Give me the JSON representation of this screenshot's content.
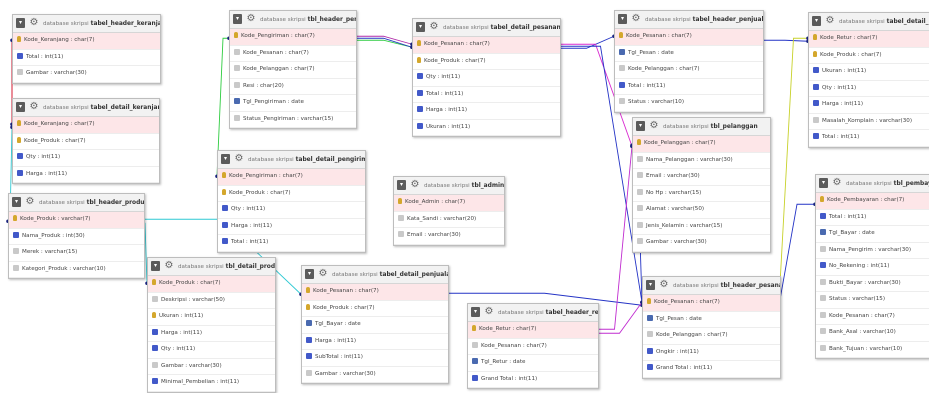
{
  "schema_prefix": "database skripsi",
  "tables": [
    {
      "id": "t_hdr_keranjang",
      "name": "tabel_header_keranjang",
      "cols": [
        {
          "label": "Kode_Keranjang : char(7)",
          "icon": "key",
          "pk": true
        },
        {
          "label": "Total : int(11)",
          "icon": "num"
        },
        {
          "label": "Gambar : varchar(30)",
          "icon": "txt"
        }
      ]
    },
    {
      "id": "t_det_keranjang",
      "name": "tabel_detail_keranjang",
      "cols": [
        {
          "label": "Kode_Keranjang : char(7)",
          "icon": "key",
          "pk": true
        },
        {
          "label": "Kode_Produk : char(7)",
          "icon": "key"
        },
        {
          "label": "Qty : int(11)",
          "icon": "num"
        },
        {
          "label": "Harga : int(11)",
          "icon": "num"
        }
      ]
    },
    {
      "id": "t_hdr_produk",
      "name": "tbl_header_produk",
      "cols": [
        {
          "label": "Kode_Produk : varchar(7)",
          "icon": "key",
          "pk": true
        },
        {
          "label": "Nama_Produk : int(30)",
          "icon": "num"
        },
        {
          "label": "Merek : varchar(15)",
          "icon": "txt"
        },
        {
          "label": "Kategori_Produk : varchar(10)",
          "icon": "txt"
        }
      ]
    },
    {
      "id": "t_hdr_pengiriman",
      "name": "tbl_header_pengiriman",
      "cols": [
        {
          "label": "Kode_Pengiriman : char(7)",
          "icon": "key",
          "pk": true
        },
        {
          "label": "Kode_Pesanan : char(7)",
          "icon": "txt"
        },
        {
          "label": "Kode_Pelanggan : char(7)",
          "icon": "txt"
        },
        {
          "label": "Resi : char(20)",
          "icon": "txt"
        },
        {
          "label": "Tgl_Pengiriman : date",
          "icon": "date"
        },
        {
          "label": "Status_Pengiriman : varchar(15)",
          "icon": "txt"
        }
      ]
    },
    {
      "id": "t_det_pengiriman",
      "name": "tabel_detail_pengiriman",
      "cols": [
        {
          "label": "Kode_Pengiriman : char(7)",
          "icon": "key",
          "pk": true
        },
        {
          "label": "Kode_Produk : char(7)",
          "icon": "key"
        },
        {
          "label": "Qty : int(11)",
          "icon": "num"
        },
        {
          "label": "Harga : int(11)",
          "icon": "num"
        },
        {
          "label": "Total : int(11)",
          "icon": "num"
        }
      ]
    },
    {
      "id": "t_det_pesanan",
      "name": "tabel_detail_pesanan",
      "cols": [
        {
          "label": "Kode_Pesanan : char(7)",
          "icon": "key",
          "pk": true
        },
        {
          "label": "Kode_Produk : char(7)",
          "icon": "key"
        },
        {
          "label": "Qty : int(11)",
          "icon": "num"
        },
        {
          "label": "Total : int(11)",
          "icon": "num"
        },
        {
          "label": "Harga : int(11)",
          "icon": "num"
        },
        {
          "label": "Ukuran : int(11)",
          "icon": "num"
        }
      ]
    },
    {
      "id": "t_admin",
      "name": "tbl_admin",
      "cols": [
        {
          "label": "Kode_Admin : char(7)",
          "icon": "key",
          "pk": true
        },
        {
          "label": "Kata_Sandi : varchar(20)",
          "icon": "txt"
        },
        {
          "label": "Email : varchar(30)",
          "icon": "txt"
        }
      ]
    },
    {
      "id": "t_det_produk",
      "name": "tbl_detail_produk",
      "cols": [
        {
          "label": "Kode_Produk : char(7)",
          "icon": "key",
          "pk": true
        },
        {
          "label": "Deskripsi : varchar(50)",
          "icon": "txt"
        },
        {
          "label": "Ukuran : int(11)",
          "icon": "key"
        },
        {
          "label": "Harga : int(11)",
          "icon": "num"
        },
        {
          "label": "Qty : int(11)",
          "icon": "num"
        },
        {
          "label": "Gambar : varchar(30)",
          "icon": "txt"
        },
        {
          "label": "Minimal_Pembelian : int(11)",
          "icon": "num"
        }
      ]
    },
    {
      "id": "t_det_penjualan",
      "name": "tabel_detail_penjualan",
      "cols": [
        {
          "label": "Kode_Pesanan : char(7)",
          "icon": "key",
          "pk": true
        },
        {
          "label": "Kode_Produk : char(7)",
          "icon": "key"
        },
        {
          "label": "Tgl_Bayar : date",
          "icon": "date"
        },
        {
          "label": "Harga : int(11)",
          "icon": "num"
        },
        {
          "label": "SubTotal : int(11)",
          "icon": "num"
        },
        {
          "label": "Gambar : varchar(30)",
          "icon": "txt"
        }
      ]
    },
    {
      "id": "t_hdr_retur",
      "name": "tabel_header_retur",
      "cols": [
        {
          "label": "Kode_Retur : char(7)",
          "icon": "key",
          "pk": true
        },
        {
          "label": "Kode_Pesanan : char(7)",
          "icon": "txt"
        },
        {
          "label": "Tgl_Retur : date",
          "icon": "date"
        },
        {
          "label": "Grand Total : int(11)",
          "icon": "num"
        }
      ]
    },
    {
      "id": "t_hdr_penjualan",
      "name": "tabel_header_penjualan",
      "cols": [
        {
          "label": "Kode_Pesanan : char(7)",
          "icon": "key",
          "pk": true
        },
        {
          "label": "Tgl_Pesan : date",
          "icon": "date"
        },
        {
          "label": "Kode_Pelanggan : char(7)",
          "icon": "txt"
        },
        {
          "label": "Total : int(11)",
          "icon": "num"
        },
        {
          "label": "Status : varchar(10)",
          "icon": "txt"
        }
      ]
    },
    {
      "id": "t_pelanggan",
      "name": "tbl_pelanggan",
      "cols": [
        {
          "label": "Kode_Pelanggan : char(7)",
          "icon": "key",
          "pk": true
        },
        {
          "label": "Nama_Pelanggan : varchar(30)",
          "icon": "txt"
        },
        {
          "label": "Email : varchar(30)",
          "icon": "txt"
        },
        {
          "label": "No Hp : varchar(15)",
          "icon": "txt"
        },
        {
          "label": "Alamat : varchar(50)",
          "icon": "txt"
        },
        {
          "label": "Jenis_Kelamin : varchar(15)",
          "icon": "txt"
        },
        {
          "label": "Gambar : varchar(30)",
          "icon": "txt"
        }
      ]
    },
    {
      "id": "t_hdr_pesanan",
      "name": "tbl_header_pesanan",
      "cols": [
        {
          "label": "Kode_Pesanan : char(7)",
          "icon": "key",
          "pk": true
        },
        {
          "label": "Tgl_Pesan : date",
          "icon": "date"
        },
        {
          "label": "Kode_Pelanggan : char(7)",
          "icon": "txt"
        },
        {
          "label": "Ongkir : int(11)",
          "icon": "num"
        },
        {
          "label": "Grand Total : int(11)",
          "icon": "num"
        }
      ]
    },
    {
      "id": "t_det_retur",
      "name": "tabel_detail_retur",
      "cols": [
        {
          "label": "Kode_Retur : char(7)",
          "icon": "key",
          "pk": true
        },
        {
          "label": "Kode_Produk : char(7)",
          "icon": "key"
        },
        {
          "label": "Ukuran : int(11)",
          "icon": "num"
        },
        {
          "label": "Qty : int(11)",
          "icon": "num"
        },
        {
          "label": "Harga : int(11)",
          "icon": "num"
        },
        {
          "label": "Masalah_Komplain : varchar(30)",
          "icon": "txt"
        },
        {
          "label": "Total : int(11)",
          "icon": "num"
        }
      ]
    },
    {
      "id": "t_pembayaran",
      "name": "tbl_pembayaran",
      "cols": [
        {
          "label": "Kode_Pembayaran : char(7)",
          "icon": "key",
          "pk": true
        },
        {
          "label": "Total : int(11)",
          "icon": "num"
        },
        {
          "label": "Tgl_Bayar : date",
          "icon": "date"
        },
        {
          "label": "Nama_Pengirim : varchar(30)",
          "icon": "txt"
        },
        {
          "label": "No_Rekening : int(11)",
          "icon": "num"
        },
        {
          "label": "Bukti_Bayar : varchar(30)",
          "icon": "txt"
        },
        {
          "label": "Status : varchar(15)",
          "icon": "txt"
        },
        {
          "label": "Kode_Pesanan : char(7)",
          "icon": "txt"
        },
        {
          "label": "Bank_Asal : varchar(10)",
          "icon": "txt"
        },
        {
          "label": "Bank_Tujuan : varchar(10)",
          "icon": "txt"
        }
      ]
    }
  ],
  "relations": [
    {
      "from": "t_hdr_keranjang",
      "to": "t_det_keranjang",
      "color": "#d0021b"
    },
    {
      "from": "t_hdr_produk",
      "to": "t_det_keranjang",
      "color": "#2fc9d3"
    },
    {
      "from": "t_hdr_produk",
      "to": "t_det_produk",
      "color": "#2fc9d3"
    },
    {
      "from": "t_hdr_produk",
      "to": "t_det_penjualan",
      "color": "#2fc9d3"
    },
    {
      "from": "t_hdr_pengiriman",
      "to": "t_det_pengiriman",
      "color": "#2ecc40"
    },
    {
      "from": "t_hdr_pengiriman",
      "to": "t_det_pesanan",
      "color": "#2ecc40"
    },
    {
      "from": "t_hdr_pengiriman",
      "to": "t_det_pesanan",
      "color": "#b02ca8"
    },
    {
      "from": "t_hdr_pengiriman",
      "to": "t_det_pesanan",
      "color": "#2433c5"
    },
    {
      "from": "t_det_pesanan",
      "to": "t_hdr_penjualan",
      "color": "#2433c5"
    },
    {
      "from": "t_det_pesanan",
      "to": "t_pelanggan",
      "color": "#d92ad0"
    },
    {
      "from": "t_det_pesanan",
      "to": "t_hdr_pesanan",
      "color": "#2433c5"
    },
    {
      "from": "t_hdr_penjualan",
      "to": "t_det_retur",
      "color": "#2433c5"
    },
    {
      "from": "t_det_retur",
      "to": "t_hdr_pesanan",
      "color": "#c7d12a"
    },
    {
      "from": "t_det_penjualan",
      "to": "t_hdr_pesanan",
      "color": "#2433c5"
    },
    {
      "from": "t_hdr_retur",
      "to": "t_hdr_pesanan",
      "color": "#c02cd0"
    },
    {
      "from": "t_hdr_retur",
      "to": "t_pelanggan",
      "color": "#c02cd0"
    },
    {
      "from": "t_pelanggan",
      "to": "t_hdr_pesanan",
      "color": "#2433c5"
    },
    {
      "from": "t_pembayaran",
      "to": "t_hdr_pesanan",
      "color": "#2433c5"
    }
  ]
}
